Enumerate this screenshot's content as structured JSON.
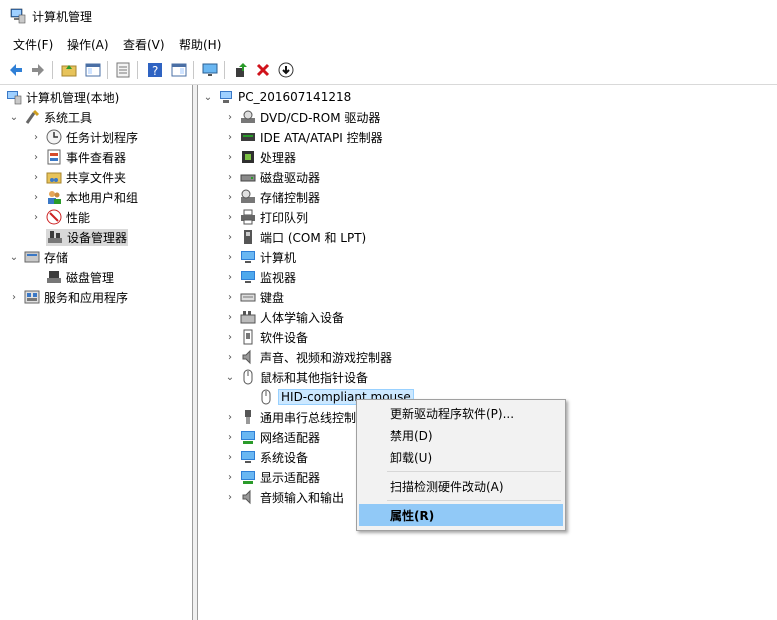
{
  "window": {
    "title": "计算机管理"
  },
  "menu": [
    {
      "label": "文件(F)"
    },
    {
      "label": "操作(A)"
    },
    {
      "label": "查看(V)"
    },
    {
      "label": "帮助(H)"
    }
  ],
  "left_tree": {
    "root": "计算机管理(本地)",
    "system_tools": "系统工具",
    "task_scheduler": "任务计划程序",
    "event_viewer": "事件查看器",
    "shared_folders": "共享文件夹",
    "local_users": "本地用户和组",
    "performance": "性能",
    "device_manager": "设备管理器",
    "storage": "存储",
    "disk_management": "磁盘管理",
    "services_apps": "服务和应用程序"
  },
  "device_tree": {
    "computer_name": "PC_201607141218",
    "categories": [
      {
        "label": "DVD/CD-ROM 驱动器"
      },
      {
        "label": "IDE ATA/ATAPI 控制器"
      },
      {
        "label": "处理器"
      },
      {
        "label": "磁盘驱动器"
      },
      {
        "label": "存储控制器"
      },
      {
        "label": "打印队列"
      },
      {
        "label": "端口 (COM 和 LPT)"
      },
      {
        "label": "计算机"
      },
      {
        "label": "监视器"
      },
      {
        "label": "键盘"
      },
      {
        "label": "人体学输入设备"
      },
      {
        "label": "软件设备"
      },
      {
        "label": "声音、视频和游戏控制器"
      },
      {
        "label": "鼠标和其他指针设备"
      },
      {
        "label": "通用串行总线控制"
      },
      {
        "label": "网络适配器"
      },
      {
        "label": "系统设备"
      },
      {
        "label": "显示适配器"
      },
      {
        "label": "音频输入和输出"
      }
    ],
    "hid_mouse": "HID-compliant mouse"
  },
  "context_menu": {
    "update_driver": "更新驱动程序软件(P)...",
    "disable": "禁用(D)",
    "uninstall": "卸载(U)",
    "scan": "扫描检测硬件改动(A)",
    "properties": "属性(R)"
  }
}
